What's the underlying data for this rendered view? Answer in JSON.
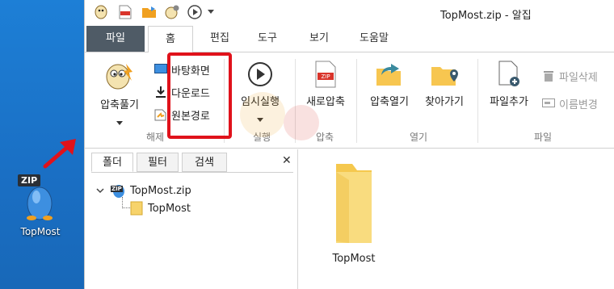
{
  "desktop": {
    "icon_badge": "ZIP",
    "icon_label": "TopMost"
  },
  "window": {
    "title": "TopMost.zip - 알집",
    "quick_access": [
      "app-icon",
      "zip-new-icon",
      "folder-open-icon",
      "settings-icon",
      "run-icon",
      "dropdown-icon"
    ]
  },
  "tabs": [
    {
      "label": "파일"
    },
    {
      "label": "홈"
    },
    {
      "label": "편집"
    },
    {
      "label": "도구"
    },
    {
      "label": "보기"
    },
    {
      "label": "도움말"
    }
  ],
  "ribbon": {
    "extract": {
      "big_label": "압축풀기",
      "small": [
        "바탕화면",
        "다운로드",
        "원본경로"
      ],
      "group_label": "해제"
    },
    "run": {
      "big_label": "임시실행",
      "group_label": "실행"
    },
    "compress": {
      "big_label": "새로압축",
      "group_label": "압축"
    },
    "open": {
      "btn1": "압축열기",
      "btn2": "찾아가기",
      "group_label": "열기"
    },
    "file": {
      "big_label": "파일추가",
      "delete": "파일삭제",
      "rename": "이름변경",
      "group_label": "파일"
    }
  },
  "left_pane": {
    "tabs": [
      "폴더",
      "필터",
      "검색"
    ],
    "close": "✕",
    "tree": [
      {
        "label": "TopMost.zip",
        "badge": "ZIP"
      },
      {
        "label": "TopMost"
      }
    ]
  },
  "main_pane": {
    "items": [
      {
        "label": "TopMost"
      }
    ]
  },
  "colors": {
    "desktop": "#1a73c8",
    "highlight": "#e0121b",
    "file_tab": "#4f5b66",
    "folder": "#f7d36b",
    "accent_orange": "#f0a020"
  }
}
